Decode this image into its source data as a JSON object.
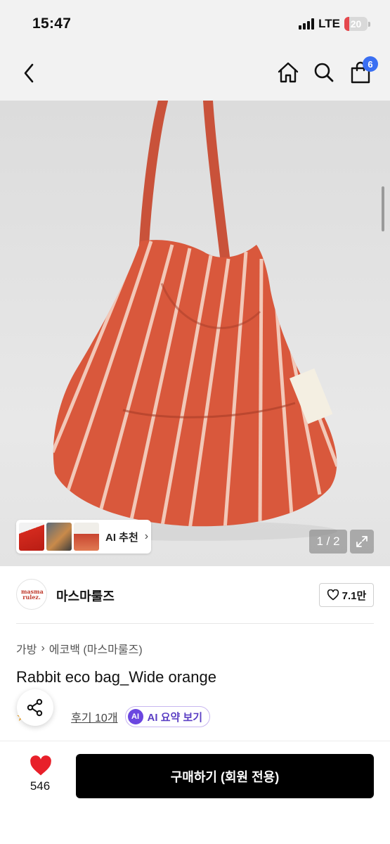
{
  "status_bar": {
    "time": "15:47",
    "network": "LTE",
    "battery": "20",
    "battery_level": 0.2
  },
  "nav": {
    "back_icon": "chevron-left-icon",
    "home_icon": "home-icon",
    "search_icon": "search-icon",
    "cart_icon": "cart-icon",
    "cart_count": "6"
  },
  "gallery": {
    "ai_recommend_label": "AI 추천",
    "page_indicator": "1 / 2",
    "expand_icon": "expand-icon"
  },
  "brand": {
    "logo_text": "masma rulez.",
    "name": "마스마룰즈",
    "like_count": "7.1만"
  },
  "breadcrumb": [
    "가방",
    "에코백 (마스마룰즈)"
  ],
  "product": {
    "title": "Rabbit eco bag_Wide orange",
    "review_link": "후기 10개",
    "ai_summary_badge": "AI",
    "ai_summary_label": "AI 요약 보기"
  },
  "bottom_bar": {
    "likes": "546",
    "buy_label": "구매하기 (회원 전용)"
  },
  "colors": {
    "accent_blue": "#3a6ff2",
    "buy_button": "#000000",
    "heart": "#e8202a",
    "bag_orange": "#d9583c",
    "ai_purple": "#6b46e0"
  }
}
